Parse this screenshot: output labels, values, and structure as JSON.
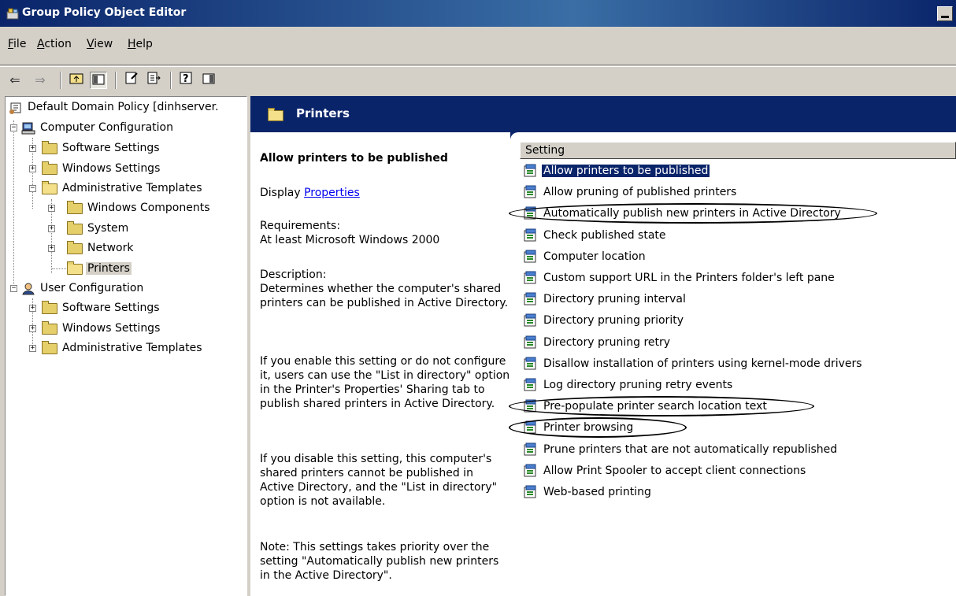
{
  "window": {
    "title": "Group Policy Object Editor"
  },
  "menu": [
    {
      "label": "File",
      "key": "F",
      "rest": "ile"
    },
    {
      "label": "Action",
      "key": "A",
      "rest": "ction"
    },
    {
      "label": "View",
      "key": "V",
      "rest": "iew"
    },
    {
      "label": "Help",
      "key": "H",
      "rest": "elp"
    }
  ],
  "toolbar": {
    "icons": [
      "back-arrow-icon",
      "forward-arrow-icon",
      "up-folder-icon",
      "show-tree-icon",
      "properties-icon",
      "export-list-icon",
      "help-icon",
      "action-pane-icon"
    ]
  },
  "tree": {
    "root": "Default Domain Policy [dinhserver.",
    "computer_config": "Computer Configuration",
    "cc_software": "Software Settings",
    "cc_windows": "Windows Settings",
    "cc_admin": "Administrative Templates",
    "cc_admin_wincomp": "Windows Components",
    "cc_admin_system": "System",
    "cc_admin_network": "Network",
    "cc_admin_printers": "Printers",
    "user_config": "User Configuration",
    "uc_software": "Software Settings",
    "uc_windows": "Windows Settings",
    "uc_admin": "Administrative Templates"
  },
  "panel": {
    "title": "Printers",
    "desc_heading": "Allow printers to be published",
    "display_label": "Display",
    "properties_link": "Properties",
    "req_label": "Requirements:",
    "req_value": "At least Microsoft Windows 2000",
    "desc_label": "Description:",
    "desc_1": "Determines whether the computer's shared printers can be published in Active Directory.",
    "desc_2": "If you enable this setting or do not configure it, users can use the \"List in directory\" option in the Printer's Properties' Sharing tab to publish shared printers in Active Directory.",
    "desc_3": "If you disable this setting, this computer's shared printers cannot be published in Active Directory, and the \"List in directory\" option is not available.",
    "desc_4": "Note: This settings takes priority over the setting \"Automatically publish new printers in the Active Directory\"."
  },
  "list": {
    "column_header": "Setting",
    "items": [
      "Allow printers to be published",
      "Allow pruning of published printers",
      "Automatically publish new printers in Active Directory",
      "Check published state",
      "Computer location",
      "Custom support URL in the Printers folder's left pane",
      "Directory pruning interval",
      "Directory pruning priority",
      "Directory pruning retry",
      "Disallow installation of printers using kernel-mode drivers",
      "Log directory pruning retry events",
      "Pre-populate printer search location text",
      "Printer browsing",
      "Prune printers that are not automatically republished",
      "Allow Print Spooler to accept client connections",
      "Web-based printing"
    ],
    "selected_index": 0,
    "circled_indices": [
      2,
      11,
      12
    ]
  },
  "colors": {
    "title_bar": "#0a246a",
    "selection": "#0a246a",
    "chrome": "#d4d0c8",
    "link": "#0000ee"
  }
}
